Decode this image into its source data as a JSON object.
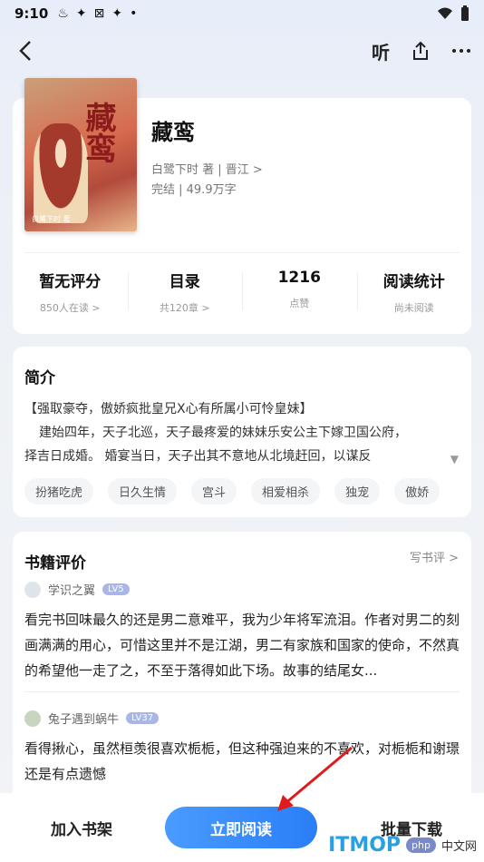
{
  "status_bar": {
    "time": "9:10"
  },
  "topbar": {
    "listen_label": "听"
  },
  "book": {
    "cover_title": "藏鸾",
    "cover_author": "白鹭下时 著",
    "title": "藏鸾",
    "author_line": "白鹭下时 著 | 晋江 >",
    "status_line": "完结 | 49.9万字"
  },
  "stats": [
    {
      "value": "暂无评分",
      "label": "850人在读 >"
    },
    {
      "value": "目录",
      "label": "共120章 >"
    },
    {
      "value": "1216",
      "label": "点赞"
    },
    {
      "value": "阅读统计",
      "label": "尚未阅读"
    }
  ],
  "intro": {
    "title": "简介",
    "line1": "【强取豪夺，傲娇疯批皇兄X心有所属小可怜皇妹】",
    "line2": "建始四年，天子北巡，天子最疼爱的妹妹乐安公主下嫁卫国公府，",
    "line3": "择吉日成婚。      婚宴当日，天子出其不意地从北境赶回，以谋反",
    "tags": [
      "扮猪吃虎",
      "日久生情",
      "宫斗",
      "相爱相杀",
      "独宠",
      "傲娇"
    ]
  },
  "reviews": {
    "title": "书籍评价",
    "write_label": "写书评 >",
    "items": [
      {
        "user": "学识之翼",
        "level": "LV5",
        "content": "看完书回味最久的还是男二意难平，我为少年将军流泪。作者对男二的刻画满满的用心，可惜这里并不是江湖，男二有家族和国家的使命，不然真的希望他一走了之，不至于落得如此下场。故事的结尾女..."
      },
      {
        "user": "兔子遇到蜗牛",
        "level": "LV37",
        "content": "看得揪心，虽然桓羡很喜欢栀栀，但这种强迫来的不喜欢，对栀栀和谢璟还是有点遗憾"
      }
    ]
  },
  "bottom_bar": {
    "shelf_label": "加入书架",
    "read_label": "立即阅读",
    "download_label": "批量下载"
  },
  "watermark": {
    "brand": "ITMOP",
    "php": "php",
    "cn": "中文网"
  },
  "colors": {
    "accent": "#2a7ef6",
    "level_badge": "#a9b7e6",
    "arrow": "#e01b1b"
  }
}
